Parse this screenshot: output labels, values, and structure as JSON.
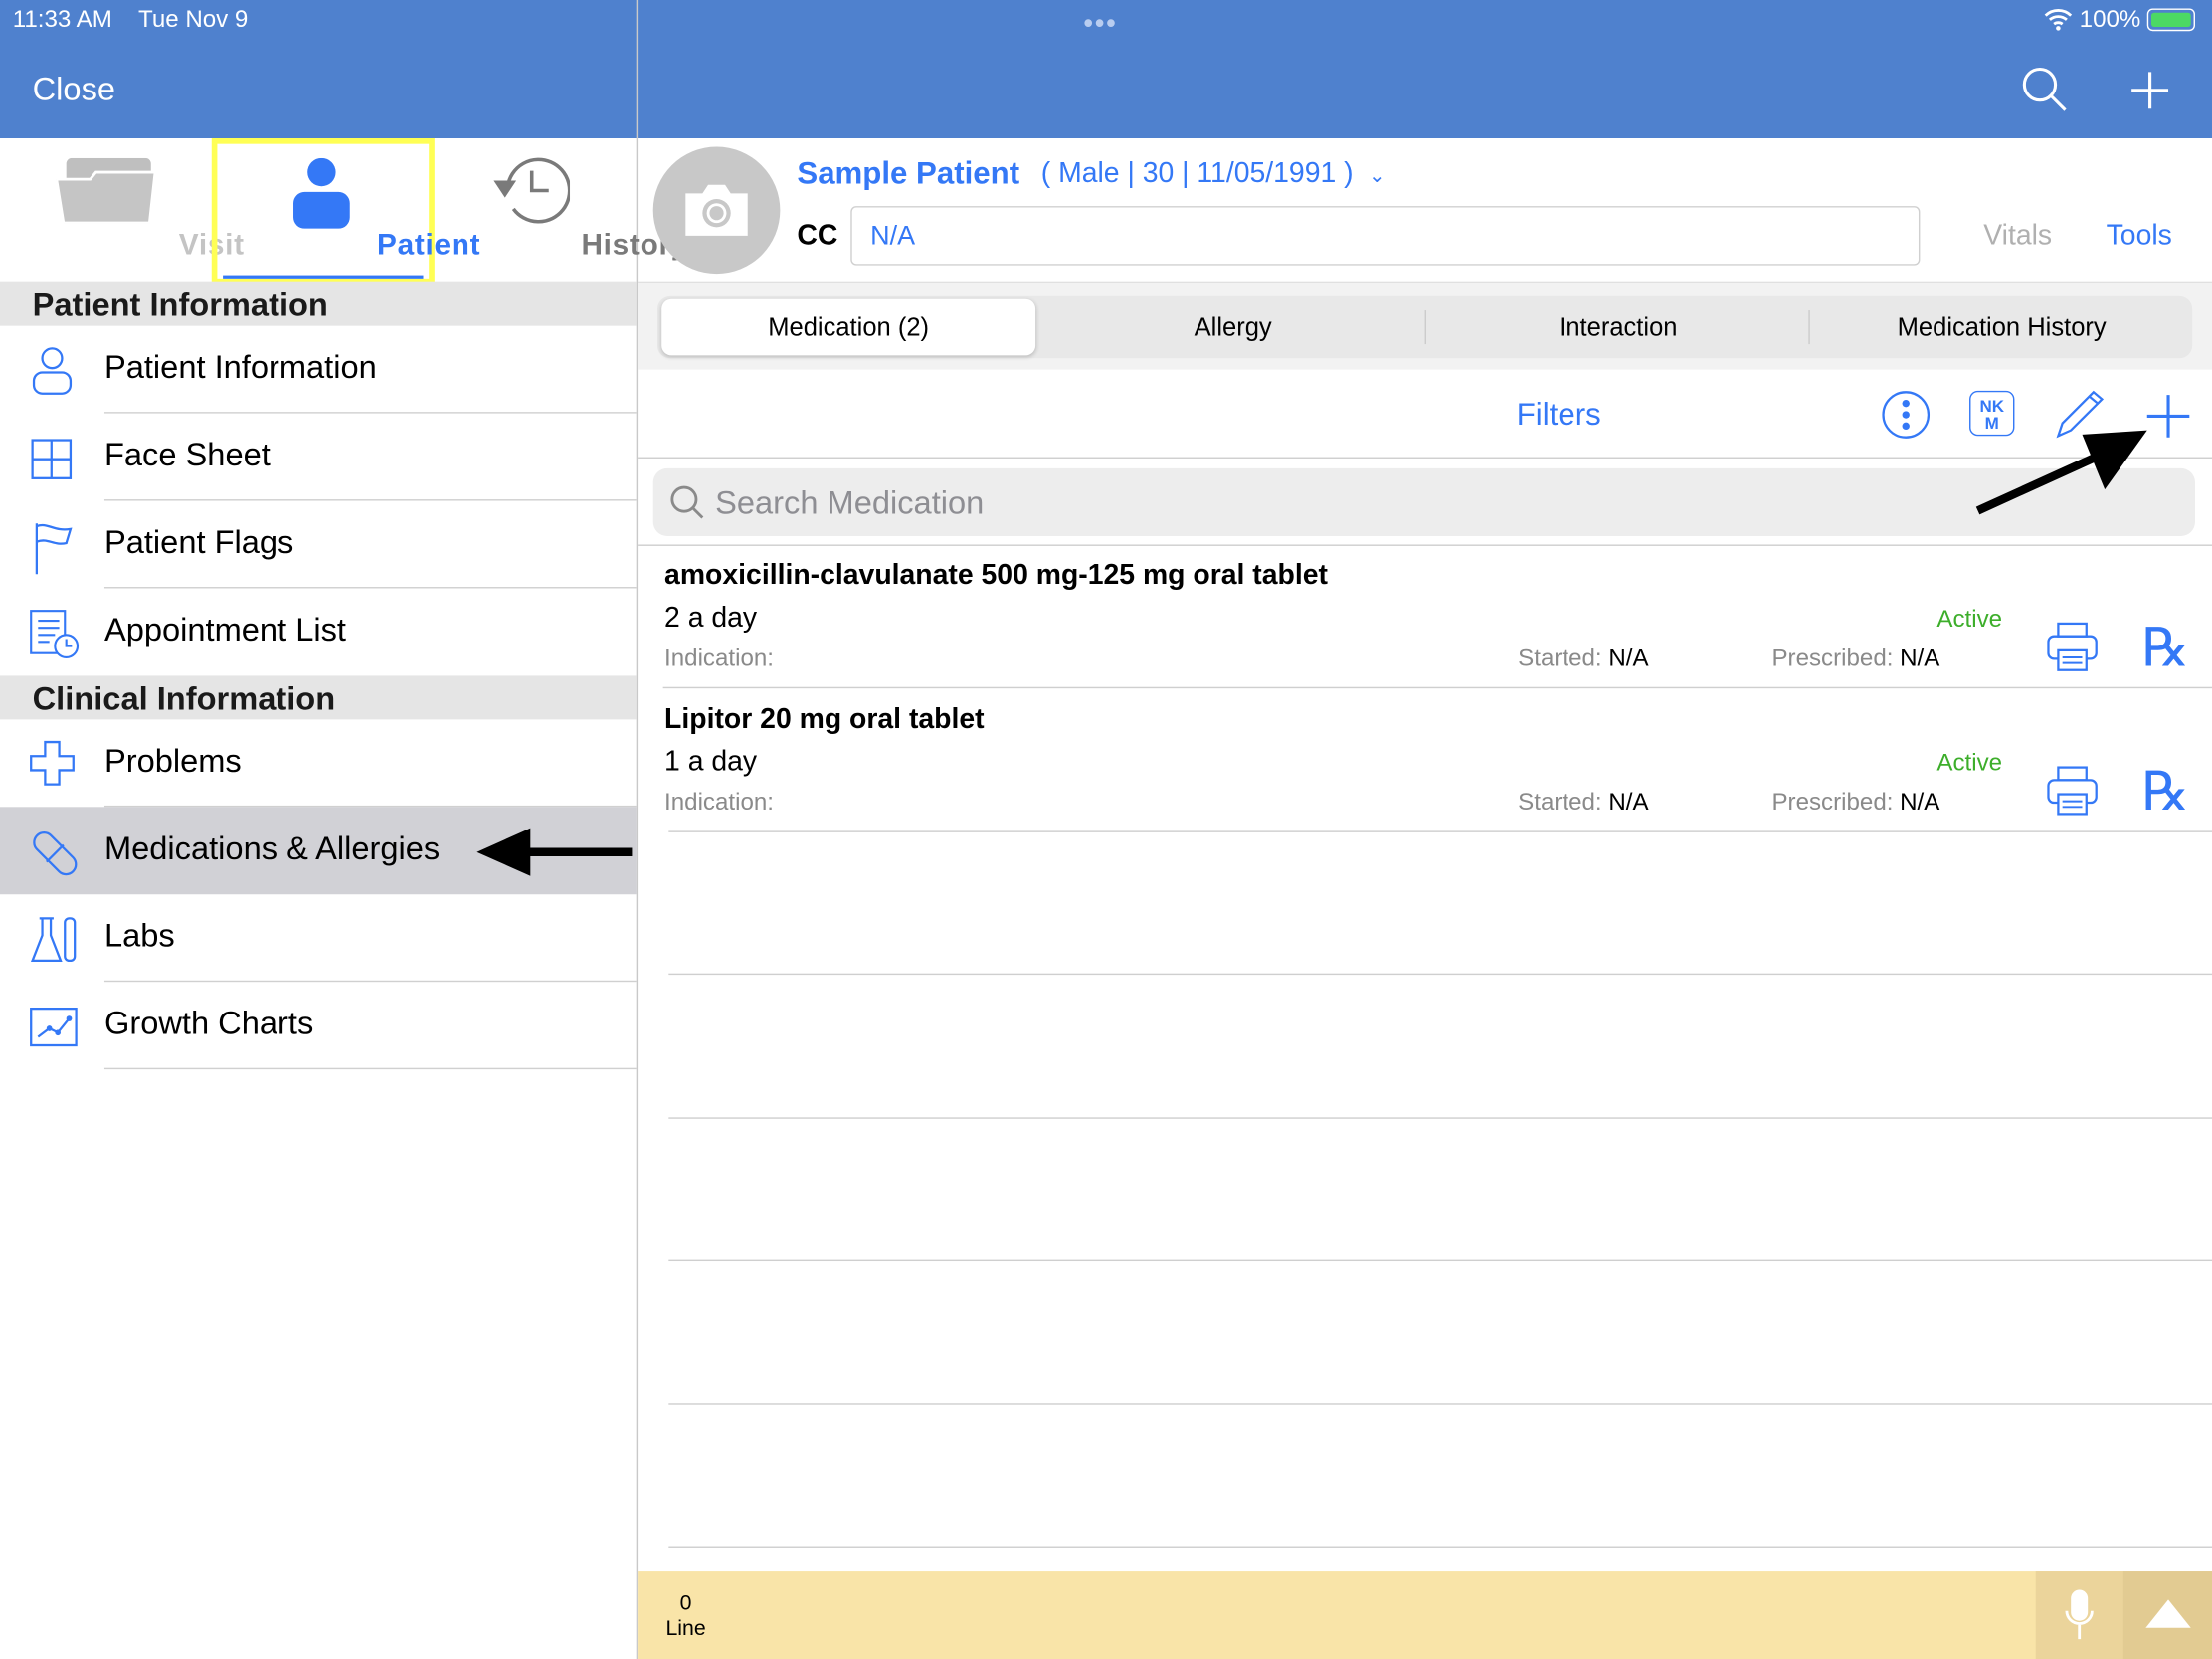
{
  "status_bar": {
    "time": "11:33 AM",
    "date": "Tue Nov 9",
    "battery": "100%"
  },
  "left_nav": {
    "close": "Close"
  },
  "tabs": [
    {
      "label": "Visit",
      "icon": "folder-icon"
    },
    {
      "label": "Patient",
      "icon": "person-icon",
      "selected": true
    },
    {
      "label": "History",
      "icon": "history-icon"
    }
  ],
  "sidebar": {
    "sections": [
      {
        "title": "Patient Information",
        "items": [
          {
            "label": "Patient Information",
            "icon": "person-outline-icon"
          },
          {
            "label": "Face Sheet",
            "icon": "grid-icon"
          },
          {
            "label": "Patient Flags",
            "icon": "flag-icon"
          },
          {
            "label": "Appointment List",
            "icon": "appointment-list-icon"
          }
        ]
      },
      {
        "title": "Clinical Information",
        "items": [
          {
            "label": "Problems",
            "icon": "cross-icon"
          },
          {
            "label": "Medications & Allergies",
            "icon": "pill-icon",
            "selected": true
          },
          {
            "label": "Labs",
            "icon": "lab-flask-icon"
          },
          {
            "label": "Growth Charts",
            "icon": "growth-chart-icon"
          }
        ]
      }
    ]
  },
  "patient": {
    "name": "Sample Patient",
    "details": "( Male | 30 | 11/05/1991 )",
    "cc_label": "CC",
    "cc_value": "N/A",
    "vitals": "Vitals",
    "tools": "Tools"
  },
  "segments": [
    "Medication (2)",
    "Allergy",
    "Interaction",
    "Medication History"
  ],
  "toolbar": {
    "filters": "Filters",
    "nkm": "NK M"
  },
  "search": {
    "placeholder": "Search Medication"
  },
  "medications": [
    {
      "name": "amoxicillin-clavulanate 500 mg-125 mg oral tablet",
      "frequency": "2 a day",
      "indication_label": "Indication:",
      "status": "Active",
      "started_label": "Started:",
      "started": "N/A",
      "prescribed_label": "Prescribed:",
      "prescribed": "N/A"
    },
    {
      "name": "Lipitor 20 mg oral tablet",
      "frequency": "1 a day",
      "indication_label": "Indication:",
      "status": "Active",
      "started_label": "Started:",
      "started": "N/A",
      "prescribed_label": "Prescribed:",
      "prescribed": "N/A"
    }
  ],
  "footer": {
    "count": "0",
    "label": "Line"
  },
  "colors": {
    "header": "#4F81CE",
    "accent": "#3478F6",
    "active": "#3DAE2B",
    "highlight": "#FFFF55",
    "footer": "#F9E4A8"
  }
}
